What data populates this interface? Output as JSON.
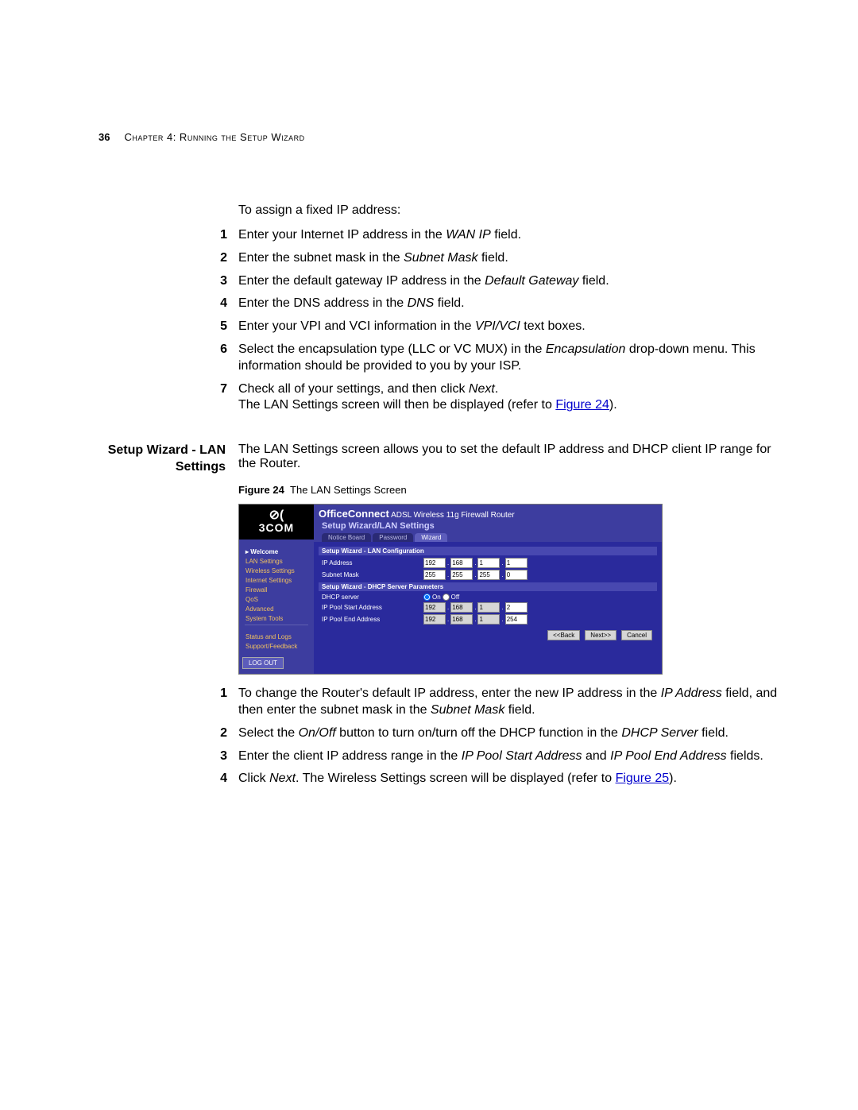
{
  "page_number": "36",
  "chapter_header": "Chapter 4: Running the Setup Wizard",
  "intro_1": "To assign a fixed IP address:",
  "steps_a": [
    {
      "n": "1",
      "html": "Enter your Internet IP address in the <span class='italic'>WAN IP</span> field."
    },
    {
      "n": "2",
      "html": "Enter the subnet mask in the <span class='italic'>Subnet Mask</span> field."
    },
    {
      "n": "3",
      "html": "Enter the default gateway IP address in the <span class='italic'>Default Gateway</span> field."
    },
    {
      "n": "4",
      "html": "Enter the DNS address in the <span class='italic'>DNS</span> field."
    },
    {
      "n": "5",
      "html": "Enter your VPI and VCI information in the <span class='italic'>VPI/VCI</span> text boxes."
    },
    {
      "n": "6",
      "html": "Select the encapsulation type (LLC or VC MUX) in the <span class='italic'>Encapsulation</span> drop-down menu. This information should be provided to you by your ISP."
    },
    {
      "n": "7",
      "html": "Check all of your settings, and then click <span class='italic'>Next</span>.<br>The LAN Settings screen will then be displayed (refer to <a class='fig-link' href='#'>Figure 24</a>)."
    }
  ],
  "section_heading": "Setup Wizard - LAN Settings",
  "section_para": "The LAN Settings screen allows you to set the default IP address and DHCP client IP range for the Router.",
  "figure_label": "Figure 24",
  "figure_caption": "The LAN Settings Screen",
  "router": {
    "brand_sym": "⊘(",
    "brand": "3COM",
    "title_strong": "OfficeConnect",
    "title_rest": " ADSL Wireless 11g Firewall Router",
    "subtitle": "Setup Wizard/LAN Settings",
    "tabs": [
      "Notice Board",
      "Password",
      "Wizard"
    ],
    "tabs_active": 2,
    "side_top": "Welcome",
    "side_sub": [
      "LAN Settings",
      "Wireless Settings",
      "Internet Settings",
      "Firewall",
      "QoS",
      "Advanced",
      "System Tools"
    ],
    "side_group2": [
      "Status and Logs",
      "Support/Feedback"
    ],
    "logout": "LOG OUT",
    "section1": "Setup Wizard - LAN Configuration",
    "row_ip_label": "IP Address",
    "row_ip": [
      "192",
      "168",
      "1",
      "1"
    ],
    "row_sm_label": "Subnet Mask",
    "row_sm": [
      "255",
      "255",
      "255",
      "0"
    ],
    "section2": "Setup Wizard - DHCP Server Parameters",
    "row_dhcp_label": "DHCP server",
    "dhcp_on": "On",
    "dhcp_off": "Off",
    "row_start_label": "IP Pool Start Address",
    "row_start": [
      "192",
      "168",
      "1",
      "2"
    ],
    "row_end_label": "IP Pool End Address",
    "row_end": [
      "192",
      "168",
      "1",
      "254"
    ],
    "btn_back": "<<Back",
    "btn_next": "Next>>",
    "btn_cancel": "Cancel"
  },
  "steps_b": [
    {
      "n": "1",
      "html": "To change the Router's default IP address, enter the new IP address in the <span class='italic'>IP Address</span> field, and then enter the subnet mask in the <span class='italic'>Subnet Mask</span> field."
    },
    {
      "n": "2",
      "html": "Select the <span class='italic'>On/Off</span> button to turn on/turn off the DHCP function in the <span class='italic'>DHCP Server</span> field."
    },
    {
      "n": "3",
      "html": "Enter the client IP address range in the <span class='italic'>IP Pool Start Address</span> and <span class='italic'>IP Pool End Address</span> fields."
    },
    {
      "n": "4",
      "html": "Click <span class='italic'>Next</span>. The Wireless Settings screen will be displayed (refer to <a class='fig-link' href='#'>Figure 25</a>)."
    }
  ]
}
